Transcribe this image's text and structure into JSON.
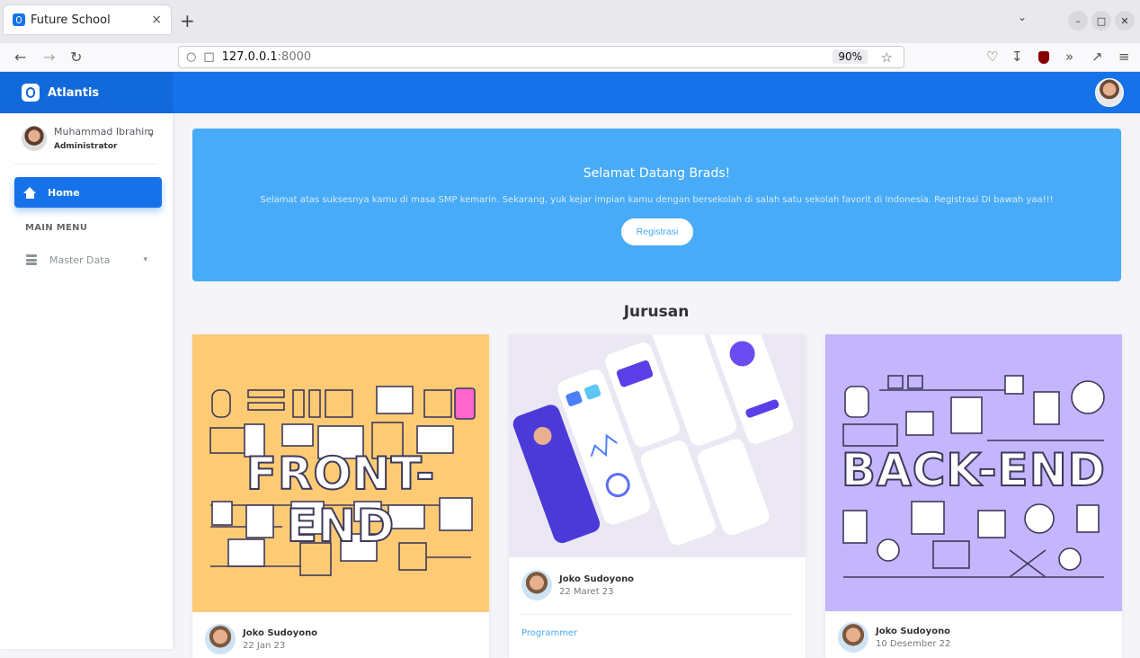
{
  "browser": {
    "tab_title": "Future School",
    "tab_close": "×",
    "new_tab": "+",
    "url_host": "127.0.0.1",
    "url_port": ":8000",
    "zoom": "90%"
  },
  "app": {
    "brand": "Atlantis"
  },
  "sidebar": {
    "user_name": "Muhammad Ibrahim",
    "user_role": "Administrator",
    "home_label": "Home",
    "menu_heading": "MAIN MENU",
    "master_data_label": "Master Data"
  },
  "hero": {
    "title": "Selamat Datang Brads!",
    "text": "Selamat atas suksesnya kamu di masa SMP kemarin. Sekarang, yuk kejar impian kamu dengan bersekolah di salah satu sekolah favorit di Indonesia. Registrasi Di bawah yaa!!!",
    "button": "Registrasi"
  },
  "section": {
    "title": "Jurusan"
  },
  "cards": [
    {
      "image_word": "FRONT-END",
      "author": "Joko Sudoyono",
      "date": "22 Jan 23"
    },
    {
      "author": "Joko Sudoyono",
      "date": "22 Maret 23",
      "tag": "Programmer"
    },
    {
      "image_word": "BACK-END",
      "author": "Joko Sudoyono",
      "date": "10 Desember 22"
    }
  ]
}
